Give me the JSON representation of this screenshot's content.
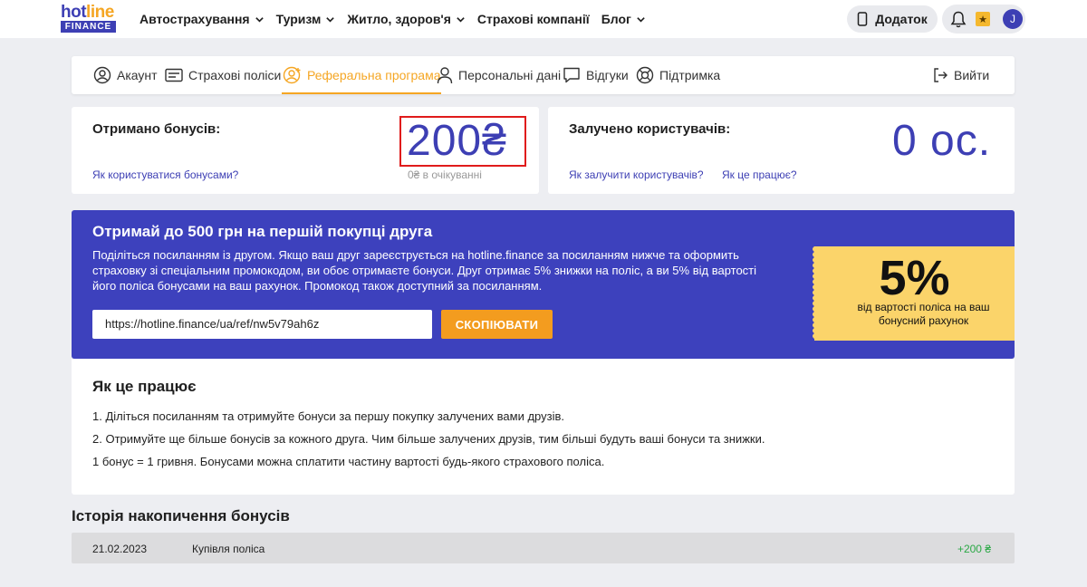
{
  "brand": {
    "logo_top": "hotline",
    "logo_bottom": "FINANCE"
  },
  "nav": [
    {
      "label": "Автострахування",
      "dropdown": true
    },
    {
      "label": "Туризм",
      "dropdown": true
    },
    {
      "label": "Житло, здоров'я",
      "dropdown": true
    },
    {
      "label": "Страхові компанії",
      "dropdown": false
    },
    {
      "label": "Блог",
      "dropdown": true
    }
  ],
  "header": {
    "app_button": "Додаток",
    "avatar_initial": "J"
  },
  "tabs": [
    {
      "label": "Акаунт",
      "icon": "user-circle-icon",
      "active": false
    },
    {
      "label": "Страхові поліси",
      "icon": "card-icon",
      "active": false
    },
    {
      "label": "Реферальна програма",
      "icon": "referral-icon",
      "active": true
    },
    {
      "label": "Персональні дані",
      "icon": "person-icon",
      "active": false
    },
    {
      "label": "Відгуки",
      "icon": "chat-icon",
      "active": false
    },
    {
      "label": "Підтримка",
      "icon": "lifebuoy-icon",
      "active": false
    }
  ],
  "logout": "Вийти",
  "bonuses": {
    "title": "Отримано бонусів:",
    "amount": "200₴",
    "pending": "0₴ в очікуванні",
    "link": "Як користуватися бонусами?"
  },
  "referrals": {
    "title": "Залучено користувачів:",
    "count": "0 ос.",
    "link_invite": "Як залучити користувачів?",
    "link_how": "Як це працює?"
  },
  "promo": {
    "heading": "Отримай до 500 грн на першій покупці друга",
    "text": "Поділіться посиланням із другом. Якщо ваш друг зареєструється на hotline.finance за посиланням нижче та оформить страховку зі спеціальним промокодом, ви обоє отримаєте бонуси. Друг отримає 5% знижки на поліс, а ви 5% від вартості його поліса бонусами на ваш рахунок. Промокод також доступний за посиланням.",
    "ref_link": "https://hotline.finance/ua/ref/nw5v79ah6z",
    "copy_label": "СКОПІЮВАТИ",
    "coupon_percent": "5%",
    "coupon_text": "від вартості поліса на ваш бонусний рахунок"
  },
  "how": {
    "heading": "Як це працює",
    "lines": [
      "1. Діліться посиланням та отримуйте бонуси за першу покупку залучених вами друзів.",
      "2. Отримуйте ще більше бонусів за кожного друга. Чим більше залучених друзів, тим більші будуть ваші бонуси та знижки.",
      "1 бонус = 1 гривня. Бонусами можна сплатити частину вартості будь-якого страхового поліса."
    ]
  },
  "history": {
    "title": "Історія накопичення бонусів",
    "rows": [
      {
        "date": "21.02.2023",
        "description": "Купівля поліса",
        "amount": "+200 ₴"
      }
    ]
  },
  "colors": {
    "accent": "#f5a623",
    "brand": "#3d3fb4",
    "promo_bg": "#3d41bd",
    "positive": "#2aa845"
  }
}
